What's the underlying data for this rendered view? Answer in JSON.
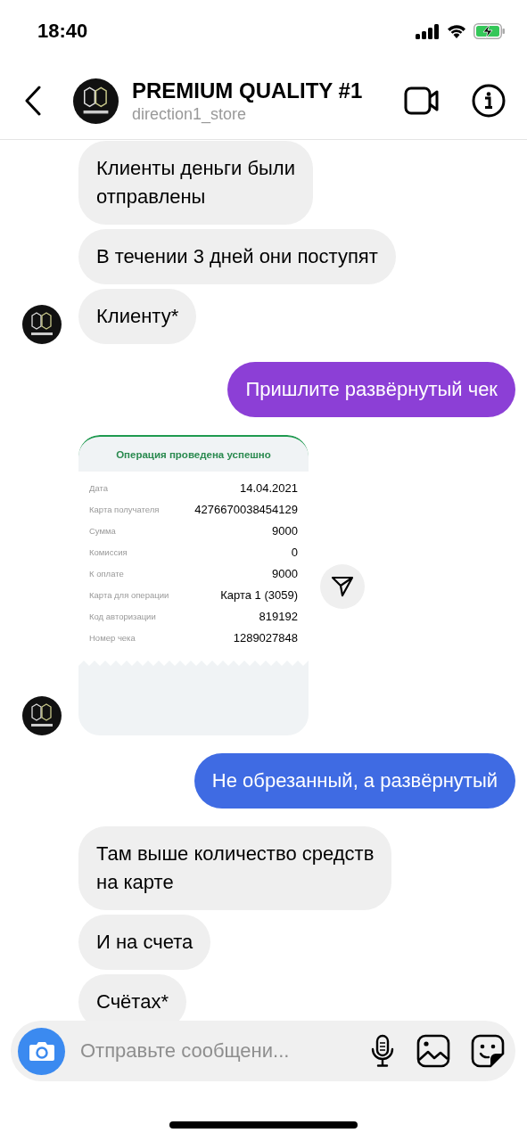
{
  "status_bar": {
    "time": "18:40"
  },
  "header": {
    "title": "PREMIUM QUALITY #1",
    "username": "direction1_store"
  },
  "messages": [
    {
      "kind": "text",
      "outgoing": false,
      "avatar": false,
      "lines": [
        "Клиенты деньги были",
        "отправлены"
      ]
    },
    {
      "kind": "text",
      "outgoing": false,
      "avatar": false,
      "lines": [
        "В течении 3 дней они поступят"
      ]
    },
    {
      "kind": "text",
      "outgoing": false,
      "avatar": true,
      "lines": [
        "Клиенту*"
      ]
    },
    {
      "kind": "text",
      "outgoing": true,
      "avatar": false,
      "color": "#8c3fd6",
      "lines": [
        "Пришлите развёрнутый чек"
      ]
    },
    {
      "kind": "receipt",
      "outgoing": false,
      "avatar": true,
      "title": "Операция проведена успешно",
      "rows": [
        {
          "label": "Дата",
          "value": "14.04.2021"
        },
        {
          "label": "Карта получателя",
          "value": "4276670038454129"
        },
        {
          "label": "Сумма",
          "value": "9000"
        },
        {
          "label": "Комиссия",
          "value": "0"
        },
        {
          "label": "К оплате",
          "value": "9000"
        },
        {
          "label": "Карта для операции",
          "value": "Карта 1 (3059)"
        },
        {
          "label": "Код авторизации",
          "value": "819192"
        },
        {
          "label": "Номер чека",
          "value": "1289027848"
        }
      ]
    },
    {
      "kind": "text",
      "outgoing": true,
      "avatar": false,
      "color": "#3f6be3",
      "lines": [
        "Не обрезанный, а развёрнутый"
      ]
    },
    {
      "kind": "text",
      "outgoing": false,
      "avatar": false,
      "lines": [
        "Там выше количество средств",
        "на карте"
      ]
    },
    {
      "kind": "text",
      "outgoing": false,
      "avatar": false,
      "lines": [
        "И на счета"
      ]
    },
    {
      "kind": "text",
      "outgoing": false,
      "avatar": false,
      "lines": [
        "Счётах*"
      ]
    }
  ],
  "composer": {
    "placeholder": "Отправьте сообщени..."
  }
}
